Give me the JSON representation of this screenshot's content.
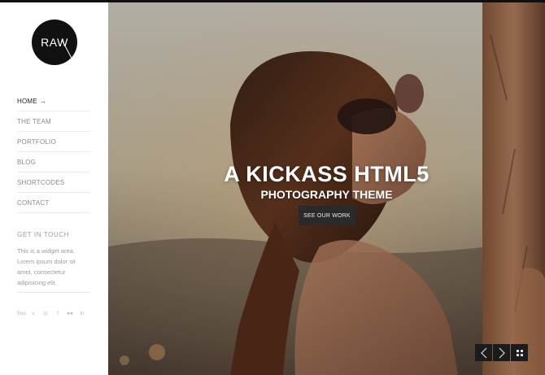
{
  "logo": {
    "text": "RAW"
  },
  "nav": {
    "items": [
      {
        "label": "HOME",
        "active": true,
        "arrow": "→"
      },
      {
        "label": "THE TEAM"
      },
      {
        "label": "PORTFOLIO"
      },
      {
        "label": "BLOG"
      },
      {
        "label": "SHORTCODES"
      },
      {
        "label": "CONTACT"
      }
    ]
  },
  "widget": {
    "title": "GET IN TOUCH",
    "text": "This is a widget area. Lorem ipsum dolor sit amet, consectetur adipisicing elit."
  },
  "social": {
    "icons": [
      "500px-icon",
      "vimeo-icon",
      "dribbble-icon",
      "facebook-icon",
      "flickr-icon",
      "linkedin-icon"
    ],
    "glyphs": [
      "5oo",
      "v",
      "◎",
      "f",
      "●●",
      "in"
    ]
  },
  "hero": {
    "headline": "A KICKASS HTML5",
    "subhead": "PHOTOGRAPHY THEME",
    "cta": "SEE OUR WORK"
  },
  "slider_controls": {
    "prev": "‹",
    "next": "›",
    "grid": "⁘"
  },
  "colors": {
    "sidebar_bg": "#ffffff",
    "logo_bg": "#111111",
    "button_bg": "#2a2a2a",
    "nav_text": "#8a8a8a",
    "nav_active": "#222222"
  }
}
